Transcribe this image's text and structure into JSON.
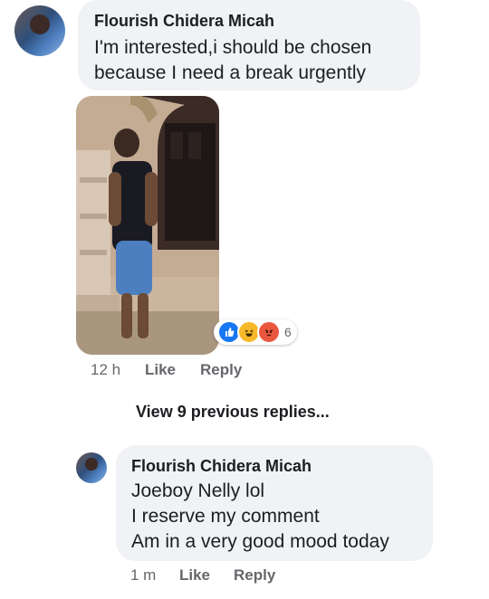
{
  "comment": {
    "author": "Flourish Chidera Micah",
    "text_line1": "I'm interested,i should be chosen",
    "text_line2": "because I need a break urgently",
    "reaction_count": "6",
    "time": "12 h",
    "like_label": "Like",
    "reply_label": "Reply",
    "reactions": [
      "like-icon",
      "haha-icon",
      "angry-icon"
    ]
  },
  "view_previous": "View 9 previous replies...",
  "reply": {
    "author": "Flourish Chidera Micah",
    "line1": "Joeboy Nelly lol",
    "line2": "I reserve my comment",
    "line3": "Am in a very good mood today",
    "time": "1 m",
    "like_label": "Like",
    "reply_label": "Reply"
  },
  "colors": {
    "bubble": "#f0f2f5",
    "like_blue": "#1877f2",
    "haha_yellow": "#f7b928",
    "angry_red": "#e9573e",
    "meta_gray": "#65676b"
  }
}
